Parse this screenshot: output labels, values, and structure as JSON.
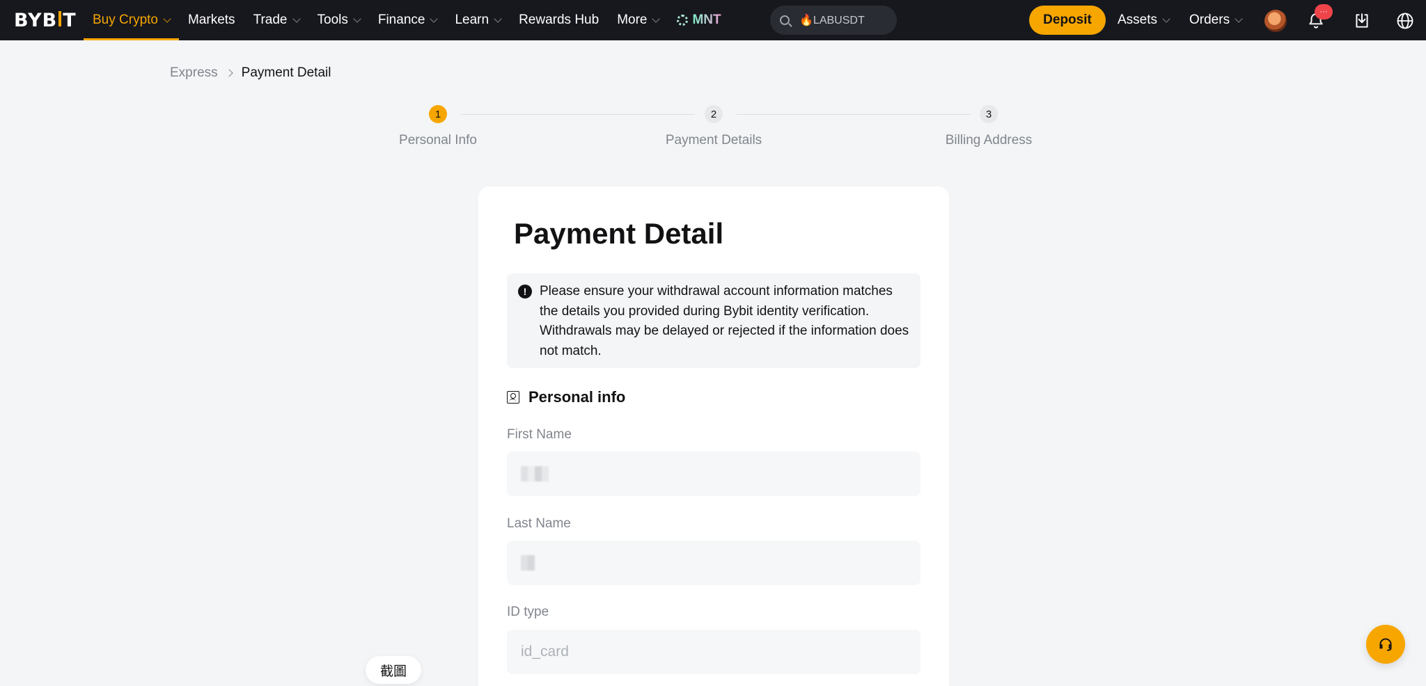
{
  "brand": {
    "logo_text_left": "BYB",
    "logo_text_right": "T",
    "accent": "#f7a600",
    "nav_bg": "#17181e"
  },
  "nav": {
    "items": [
      {
        "label": "Buy Crypto",
        "dropdown": true,
        "active": true
      },
      {
        "label": "Markets",
        "dropdown": false
      },
      {
        "label": "Trade",
        "dropdown": true
      },
      {
        "label": "Tools",
        "dropdown": true
      },
      {
        "label": "Finance",
        "dropdown": true
      },
      {
        "label": "Learn",
        "dropdown": true
      },
      {
        "label": "Rewards Hub",
        "dropdown": false
      },
      {
        "label": "More",
        "dropdown": true
      }
    ],
    "mnt_label": "MNT",
    "search_value": "🔥LABUSDT",
    "deposit_label": "Deposit",
    "assets_label": "Assets",
    "orders_label": "Orders",
    "notification_badge": "···",
    "icons": [
      "search-icon",
      "bell-icon",
      "download-icon",
      "globe-icon"
    ]
  },
  "breadcrumb": {
    "parent": "Express",
    "current": "Payment Detail"
  },
  "stepper": {
    "steps": [
      {
        "number": "1",
        "label": "Personal Info",
        "state": "active"
      },
      {
        "number": "2",
        "label": "Payment Details",
        "state": "inactive"
      },
      {
        "number": "3",
        "label": "Billing Address",
        "state": "inactive"
      }
    ]
  },
  "card": {
    "title": "Payment Detail",
    "notice": "Please ensure your withdrawal account information matches the details you provided during Bybit identity verification. Withdrawals may be delayed or rejected if the information does not match.",
    "notice_icon": "!",
    "section_title": "Personal info",
    "fields": {
      "first_name": {
        "label": "First Name",
        "value": ""
      },
      "last_name": {
        "label": "Last Name",
        "value": ""
      },
      "id_type": {
        "label": "ID type",
        "value": "id_card"
      }
    }
  },
  "floating": {
    "screenshot_label": "截圖",
    "support_icon": "headset-icon"
  }
}
